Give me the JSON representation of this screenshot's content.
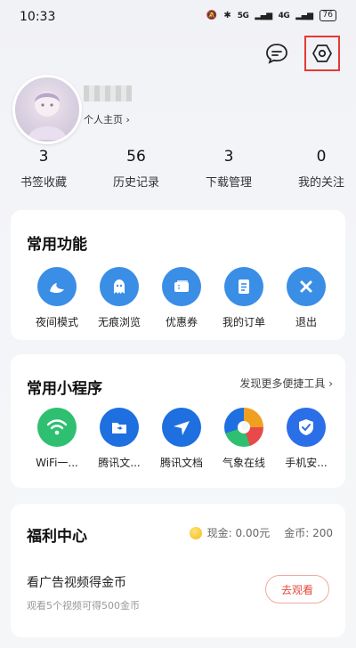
{
  "status": {
    "time": "10:33",
    "signal_a": "5G",
    "signal_b": "4G",
    "battery": "76"
  },
  "header": {
    "message_icon": "message-bubble-icon",
    "settings_icon": "settings-hexagon-icon"
  },
  "profile": {
    "homepage_label": "个人主页 ›"
  },
  "stats": [
    {
      "value": "3",
      "label": "书签收藏"
    },
    {
      "value": "56",
      "label": "历史记录"
    },
    {
      "value": "3",
      "label": "下载管理"
    },
    {
      "value": "0",
      "label": "我的关注"
    }
  ],
  "functions": {
    "title": "常用功能",
    "items": [
      {
        "label": "夜间模式",
        "icon": "night-mode-icon"
      },
      {
        "label": "无痕浏览",
        "icon": "incognito-icon"
      },
      {
        "label": "优惠券",
        "icon": "coupon-icon"
      },
      {
        "label": "我的订单",
        "icon": "order-icon"
      },
      {
        "label": "退出",
        "icon": "exit-icon"
      }
    ]
  },
  "mini_programs": {
    "title": "常用小程序",
    "more_label": "发现更多便捷工具 ›",
    "items": [
      {
        "label": "WiFi一...",
        "icon": "wifi-icon",
        "color": "#2fbf71"
      },
      {
        "label": "腾讯文...",
        "icon": "folder-icon",
        "color": "#1e6fe0"
      },
      {
        "label": "腾讯文档",
        "icon": "tencent-docs-icon",
        "color": "#1e6fe0"
      },
      {
        "label": "气象在线",
        "icon": "weather-icon",
        "color": "#f0a020"
      },
      {
        "label": "手机安...",
        "icon": "phone-security-icon",
        "color": "#2a6ee8"
      }
    ]
  },
  "welfare": {
    "title": "福利中心",
    "cash_label": "现金: 0.00元",
    "coin_label": "金币: 200",
    "task_title": "看广告视频得金币",
    "task_sub": "观看5个视频可得500金币",
    "watch_label": "去观看"
  }
}
